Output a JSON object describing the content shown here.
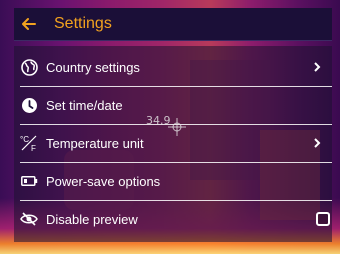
{
  "header": {
    "title": "Settings",
    "back_icon": "back-arrow-icon",
    "accent_color": "#f2a21f"
  },
  "menu": [
    {
      "icon": "globe-icon",
      "label": "Country settings",
      "has_chevron": true
    },
    {
      "icon": "clock-icon",
      "label": "Set time/date",
      "has_chevron": false
    },
    {
      "icon": "temperature-unit-icon",
      "label": "Temperature unit",
      "has_chevron": true
    },
    {
      "icon": "battery-icon",
      "label": "Power-save options",
      "has_chevron": false
    },
    {
      "icon": "eye-off-icon",
      "label": "Disable preview",
      "checkbox": true,
      "checked": false
    }
  ],
  "temp_icon_text": {
    "top": "°C",
    "bottom": "F"
  },
  "background": {
    "spot_readout": "34.9",
    "crosshair_icon": "crosshair-icon"
  }
}
